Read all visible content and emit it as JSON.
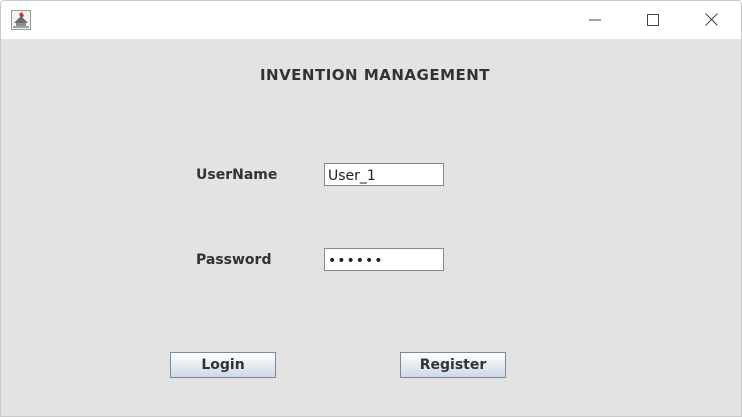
{
  "window": {
    "icon": "java-app-icon",
    "controls": {
      "minimize": "minimize-icon",
      "maximize": "maximize-icon",
      "close": "close-icon"
    }
  },
  "form": {
    "heading": "INVENTION MANAGEMENT",
    "username_label": "UserName",
    "username_value": "User_1",
    "password_label": "Password",
    "password_value": "••••••",
    "login_label": "Login",
    "register_label": "Register"
  },
  "colors": {
    "panel_background": "#e3e3e3",
    "button_gradient_bottom": "#cfd9e4",
    "border": "#7a8a99"
  }
}
